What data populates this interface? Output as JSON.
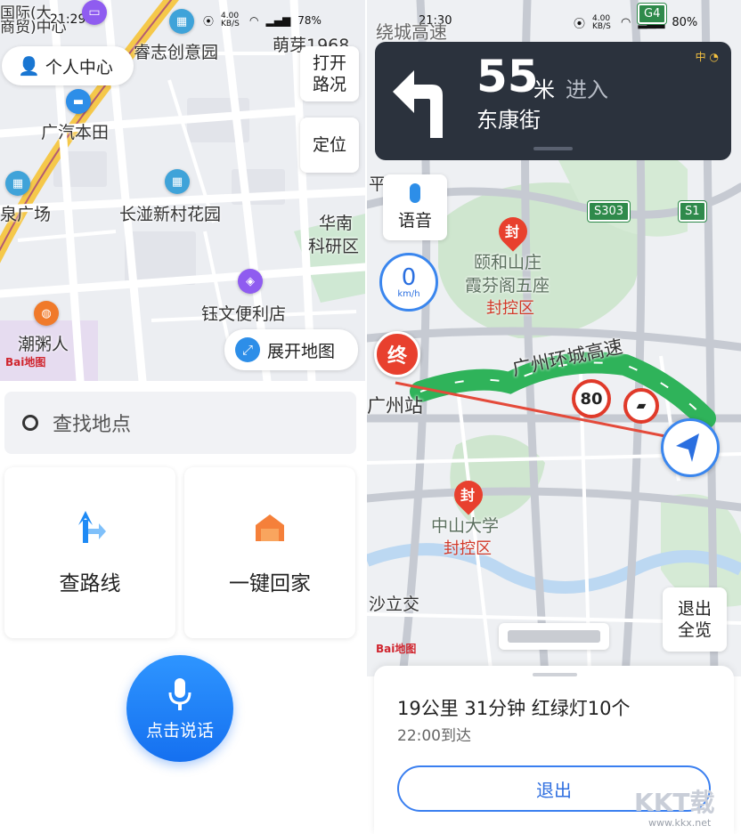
{
  "left": {
    "status": {
      "time": "21:29",
      "speed": "4.00 KB/S",
      "battery": "78%"
    },
    "map_labels": [
      "睿志创意园",
      "广汽本田",
      "长湴新村花园",
      "泉广场",
      "钰文便利店",
      "潮粥人",
      "萌芽1968",
      "华南",
      "科研区",
      "商贸)中心",
      "国际(大"
    ],
    "personal_center": "个人中心",
    "traffic_toggle": "打开路况",
    "locate": "定位",
    "expand_map": "展开地图",
    "brand": "Bai地图",
    "search_placeholder": "查找地点",
    "cards": [
      {
        "label": "查路线",
        "icon": "route-arrow-icon"
      },
      {
        "label": "一键回家",
        "icon": "home-icon"
      }
    ],
    "voice_button": "点击说话"
  },
  "right": {
    "status": {
      "time": "21:30",
      "speed": "4.00 KB/S",
      "battery": "80%"
    },
    "nav": {
      "distance": "55",
      "unit": "米",
      "action": "进入",
      "street": "东康街",
      "corner_badge": "中"
    },
    "voice": "语音",
    "speed": {
      "value": "0",
      "unit": "km/h"
    },
    "end_marker": "终",
    "map_labels": {
      "ring_road": "广州环城高速",
      "park": "颐和山庄",
      "pavilion": "霞芬阁五座",
      "lock1": "封控区",
      "university": "中山大学",
      "lock2": "封控区",
      "station": "广州站",
      "interchange": "沙立交",
      "top_road": "绕城高速",
      "left_top": "平沙立交",
      "seal1": "封",
      "seal2": "封"
    },
    "shields": [
      "S303",
      "S1",
      "G4"
    ],
    "speed_limit": "80",
    "exit_overview": "退出全览",
    "brand": "Bai地图",
    "trip": {
      "summary": "19公里 31分钟 红绿灯10个",
      "arrival": "22:00到达"
    },
    "exit": "退出"
  },
  "watermark": {
    "logo": "KKT载",
    "url": "www.kkx.net"
  },
  "colors": {
    "accent_blue": "#1570f0",
    "route_green": "#2fb35a",
    "nav_dark": "#2b323d",
    "alert_red": "#e8402e"
  }
}
